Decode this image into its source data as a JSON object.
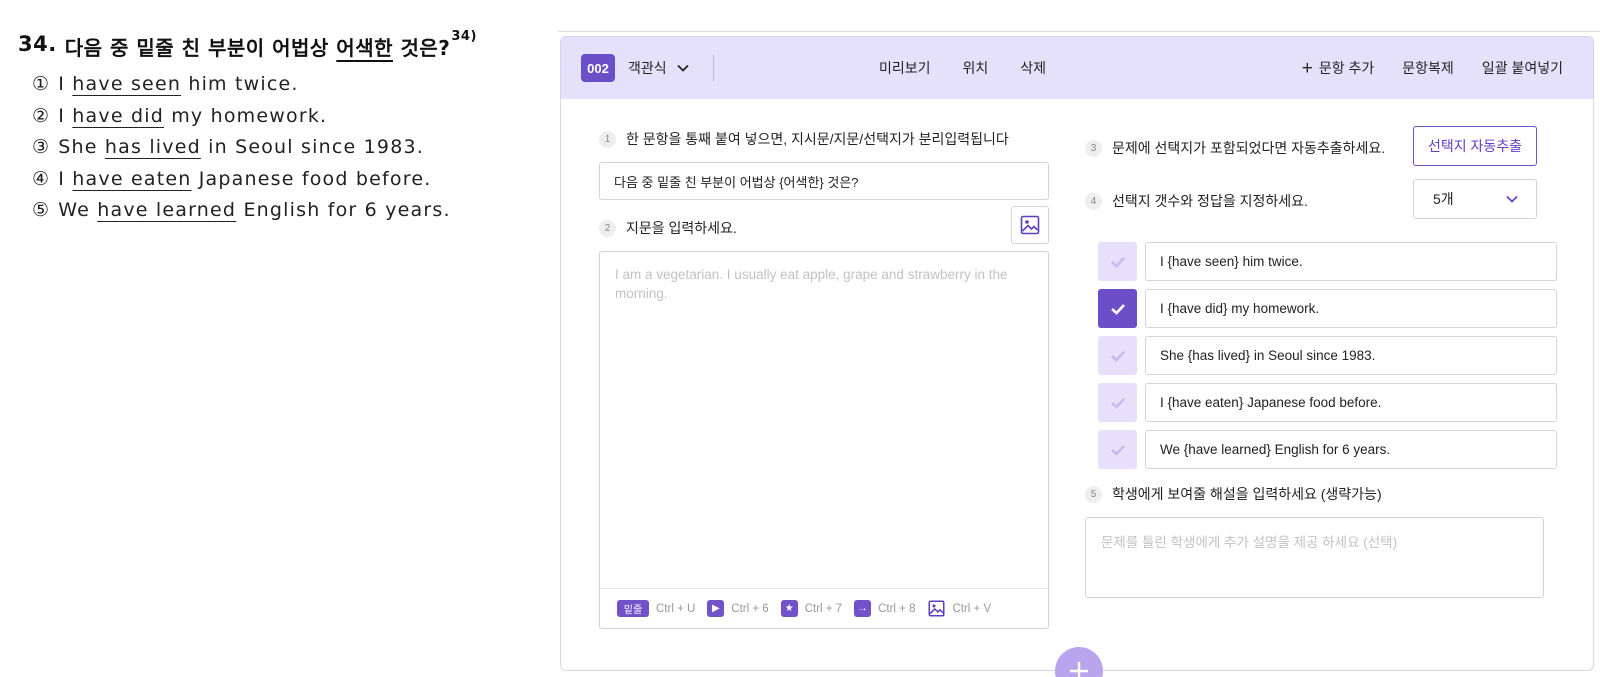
{
  "question": {
    "number": "34.",
    "title_before": "다음 중 밑줄 친 부분이 어법상",
    "title_underlined": "어색한",
    "title_after": "것은?",
    "footnote": "34)",
    "options": [
      {
        "mark": "①",
        "before": "I",
        "underlined": "have seen",
        "after": "him twice."
      },
      {
        "mark": "②",
        "before": "I",
        "underlined": "have did",
        "after": "my homework."
      },
      {
        "mark": "③",
        "before": "She",
        "underlined": "has lived",
        "after": "in Seoul since 1983."
      },
      {
        "mark": "④",
        "before": "I",
        "underlined": "have eaten",
        "after": "Japanese food before."
      },
      {
        "mark": "⑤",
        "before": "We",
        "underlined": "have learned",
        "after": "English for 6 years."
      }
    ]
  },
  "toolbar": {
    "badge": "002",
    "type_label": "객관식",
    "preview": "미리보기",
    "position": "위치",
    "delete": "삭제",
    "add_item": "문항 추가",
    "duplicate": "문항복제",
    "bulk_paste": "일괄 붙여넣기"
  },
  "steps": {
    "s1": {
      "num": "1",
      "label": "한 문항을 통째 붙여 넣으면, 지시문/지문/선택지가 분리입력됩니다"
    },
    "s2": {
      "num": "2",
      "label": "지문을 입력하세요."
    },
    "s3": {
      "num": "3",
      "label": "문제에 선택지가 포함되었다면 자동추출하세요."
    },
    "s4": {
      "num": "4",
      "label": "선택지 갯수와 정답을 지정하세요."
    },
    "s5": {
      "num": "5",
      "label": "학생에게 보여줄 해설을 입력하세요 (생략가능)"
    }
  },
  "instruction_value": "다음 중 밑줄 친 부분이 어법상 {어색한} 것은?",
  "passage_placeholder": "I am a vegetarian. I usually eat apple, grape and strawberry in the morning.",
  "shortcuts": [
    {
      "icon": "밑줄",
      "keys": "Ctrl + U"
    },
    {
      "icon": "▶",
      "keys": "Ctrl + 6"
    },
    {
      "icon": "★",
      "keys": "Ctrl + 7"
    },
    {
      "icon": "→",
      "keys": "Ctrl + 8"
    },
    {
      "icon": "image-icon",
      "keys": "Ctrl + V"
    }
  ],
  "extract_button": "선택지 자동추출",
  "choice_count": "5개",
  "choices": [
    {
      "text": "I {have seen} him twice.",
      "correct": false
    },
    {
      "text": "I {have did} my homework.",
      "correct": true
    },
    {
      "text": "She {has lived} in Seoul since 1983.",
      "correct": false
    },
    {
      "text": "I {have eaten} Japanese food before.",
      "correct": false
    },
    {
      "text": "We {have learned} English for 6 years.",
      "correct": false
    }
  ],
  "explanation_placeholder": "문제를 틀린 학생에게 추가 설명을 제공 하세요 (선택)",
  "colors": {
    "accent": "#6c4ec8",
    "toolbar_bg": "#e6e1fb",
    "check_off": "#e6e0fa",
    "fab": "#b8a5ee"
  }
}
